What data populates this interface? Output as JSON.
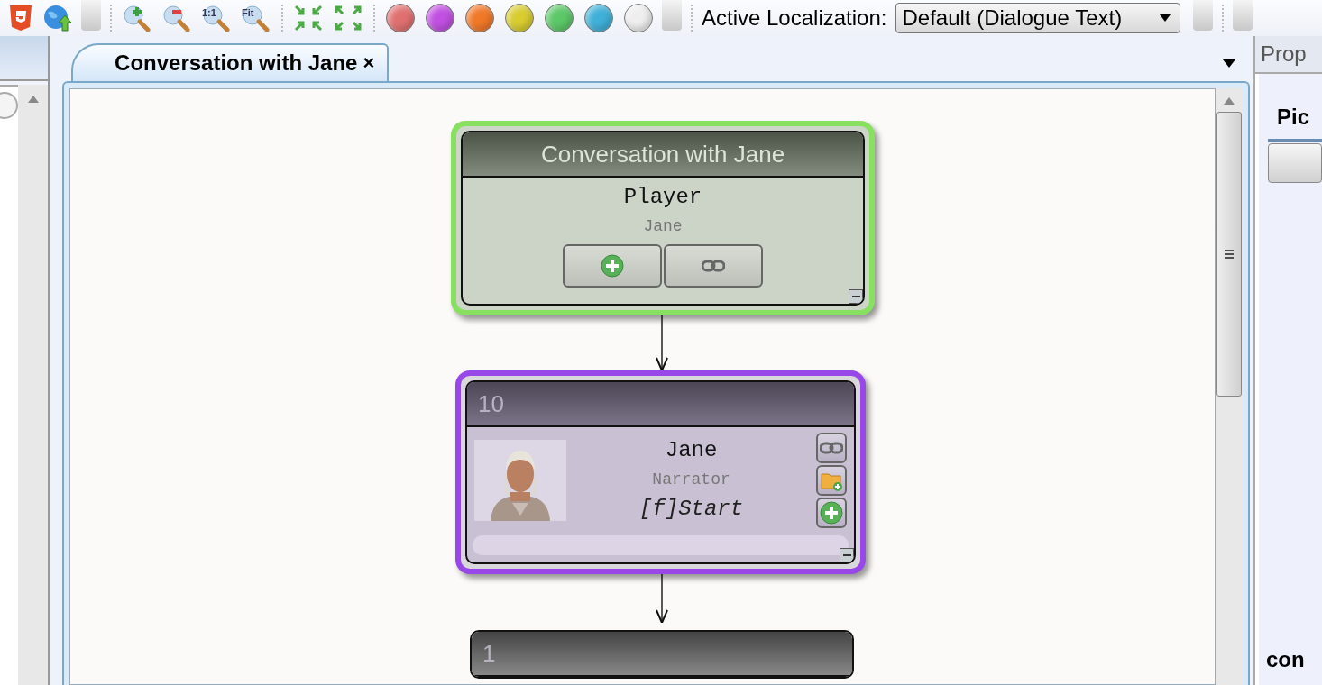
{
  "toolbar": {
    "tools": [
      {
        "kind": "html5"
      },
      {
        "kind": "upload"
      },
      {
        "kind": "overflow"
      },
      {
        "kind": "zoom-in"
      },
      {
        "kind": "zoom-out"
      },
      {
        "kind": "zoom-actual",
        "label": "1:1"
      },
      {
        "kind": "zoom-fit",
        "label": "Fit"
      },
      {
        "kind": "collapse"
      },
      {
        "kind": "expand"
      }
    ],
    "colors": [
      {
        "color": "#e07070"
      },
      {
        "color": "#c050e0"
      },
      {
        "color": "#f07828"
      },
      {
        "color": "#d8cc30"
      },
      {
        "color": "#5cc868"
      },
      {
        "color": "#40b0d8"
      },
      {
        "color": "#eeeeee"
      }
    ],
    "localization": {
      "label": "Active Localization:",
      "value": "Default (Dialogue Text)"
    }
  },
  "tabs": [
    {
      "label": "Conversation with Jane",
      "close": "×",
      "selected": true
    }
  ],
  "nodes": [
    {
      "kind": "start",
      "title": "Conversation with Jane",
      "actor": "Player",
      "conversant": "Jane",
      "color": "#88e060",
      "buttons": [
        {
          "kind": "add"
        },
        {
          "kind": "link"
        }
      ]
    },
    {
      "kind": "dialogue",
      "title": "10",
      "actor": "Jane",
      "conversant": "Narrator",
      "text": "[f]Start",
      "color": "#9848e8",
      "buttons": [
        {
          "kind": "link"
        },
        {
          "kind": "folder-add"
        },
        {
          "kind": "add"
        }
      ]
    },
    {
      "kind": "dialogue",
      "title": "1"
    }
  ],
  "right_panel": {
    "tab": "Prop",
    "heading": "Pic",
    "footer": "con"
  }
}
